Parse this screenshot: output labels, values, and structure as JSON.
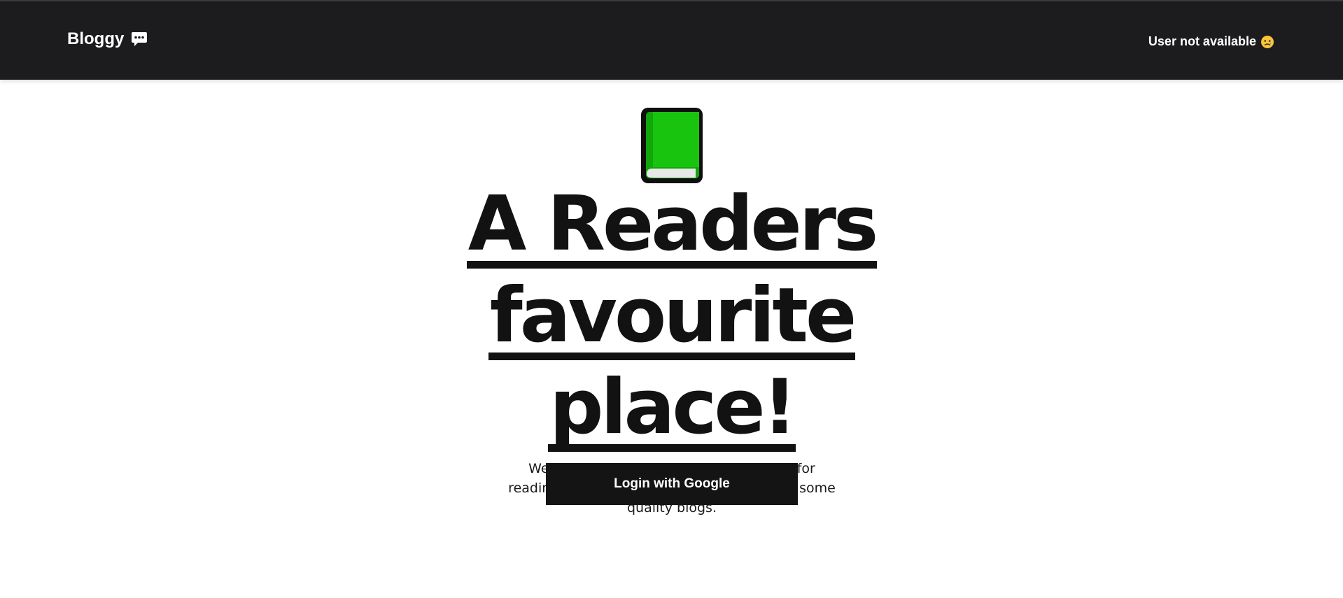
{
  "navbar": {
    "brand_label": "Bloggy",
    "brand_icon": "speech-bubble-icon",
    "user_status": "User not available",
    "user_status_icon": "sad-face-icon"
  },
  "hero": {
    "hero_icon": "green-book-icon",
    "headline_line1": "A Readers",
    "headline_line2": "favourite",
    "headline_line3": "place!",
    "subtitle": "We provide high quality online resource for reading logs. Just sign up and start reading some quality blogs.",
    "login_button_label": "Login with Google"
  },
  "colors": {
    "navbar_bg": "#1c1c1e",
    "text_dark": "#121212",
    "book_green": "#18c40e",
    "button_bg": "#141414"
  }
}
